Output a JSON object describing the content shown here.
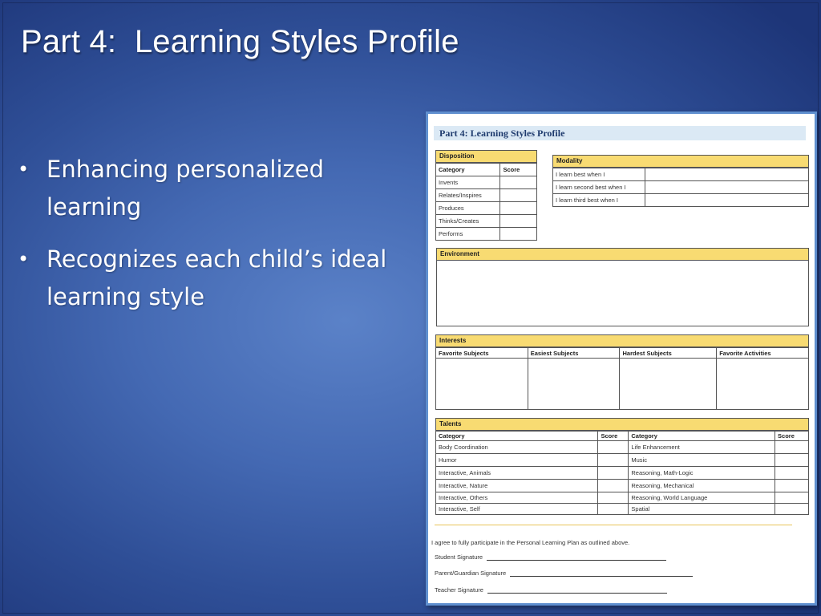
{
  "slide": {
    "title": "Part 4:  Learning Styles Profile",
    "bullets": [
      "Enhancing personalized learning",
      "Recognizes each child’s ideal learning style"
    ]
  },
  "form": {
    "title": "Part 4: Learning Styles Profile",
    "disposition": {
      "header": "Disposition",
      "col_category": "Category",
      "col_score": "Score",
      "rows": [
        "Invents",
        "Relates/Inspires",
        "Produces",
        "Thinks/Creates",
        "Performs"
      ]
    },
    "modality": {
      "header": "Modality",
      "rows": [
        "I learn best when I",
        "I learn second best when I",
        "I learn third best when I"
      ]
    },
    "environment": {
      "header": "Environment"
    },
    "interests": {
      "header": "Interests",
      "columns": [
        "Favorite Subjects",
        "Easiest Subjects",
        "Hardest Subjects",
        "Favorite Activities"
      ]
    },
    "talents": {
      "header": "Talents",
      "col_category": "Category",
      "col_score": "Score",
      "left": [
        "Body Coordination",
        "Humor",
        "Interactive, Animals",
        "Interactive, Nature",
        "Interactive, Others",
        "Interactive, Self"
      ],
      "right": [
        "Life Enhancement",
        "Music",
        "Reasoning, Math-Logic",
        "Reasoning, Mechanical",
        "Reasoning, World Language",
        "Spatial"
      ]
    },
    "agreement": "I agree to fully participate in the Personal Learning Plan as outlined above.",
    "signatures": {
      "student": "Student Signature",
      "parent": "Parent/Guardian Signature",
      "teacher": "Teacher Signature"
    }
  }
}
